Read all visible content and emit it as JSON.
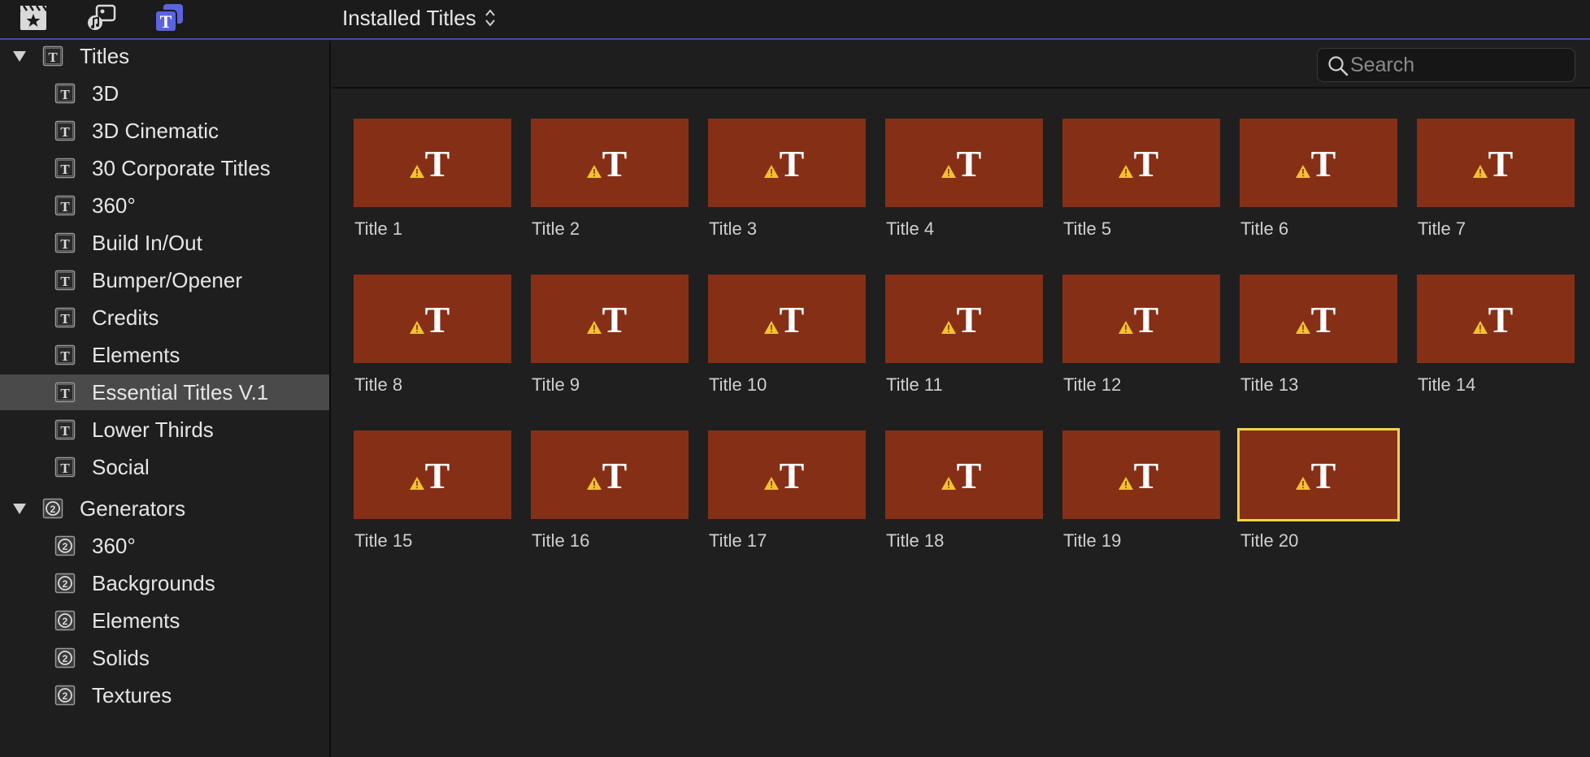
{
  "toolbar": {
    "browser_title": "Installed Titles",
    "icons": [
      "clapper-star-icon",
      "music-photo-icon",
      "titles-generators-icon"
    ],
    "accent_color": "#5b63e0"
  },
  "sidebar": {
    "titles_group": {
      "label": "Titles",
      "icon": "title-t-icon",
      "expanded": true,
      "items": [
        {
          "label": "3D"
        },
        {
          "label": "3D Cinematic"
        },
        {
          "label": "30 Corporate Titles"
        },
        {
          "label": "360°"
        },
        {
          "label": "Build In/Out"
        },
        {
          "label": "Bumper/Opener"
        },
        {
          "label": "Credits"
        },
        {
          "label": "Elements"
        },
        {
          "label": "Essential Titles V.1",
          "selected": true
        },
        {
          "label": "Lower Thirds"
        },
        {
          "label": "Social"
        }
      ]
    },
    "generators_group": {
      "label": "Generators",
      "icon": "generator-2-icon",
      "expanded": true,
      "items": [
        {
          "label": "360°"
        },
        {
          "label": "Backgrounds"
        },
        {
          "label": "Elements"
        },
        {
          "label": "Solids"
        },
        {
          "label": "Textures"
        }
      ]
    }
  },
  "search": {
    "placeholder": "Search",
    "value": ""
  },
  "grid": {
    "thumb_color": "#862f17",
    "selected_outline_color": "#f2d24a",
    "tiles": [
      {
        "label": "Title 1"
      },
      {
        "label": "Title 2"
      },
      {
        "label": "Title 3"
      },
      {
        "label": "Title 4"
      },
      {
        "label": "Title 5"
      },
      {
        "label": "Title 6"
      },
      {
        "label": "Title 7"
      },
      {
        "label": "Title 8"
      },
      {
        "label": "Title 9"
      },
      {
        "label": "Title 10"
      },
      {
        "label": "Title 11"
      },
      {
        "label": "Title 12"
      },
      {
        "label": "Title 13"
      },
      {
        "label": "Title 14"
      },
      {
        "label": "Title 15"
      },
      {
        "label": "Title 16"
      },
      {
        "label": "Title 17"
      },
      {
        "label": "Title 18"
      },
      {
        "label": "Title 19"
      },
      {
        "label": "Title 20",
        "selected": true
      }
    ]
  }
}
